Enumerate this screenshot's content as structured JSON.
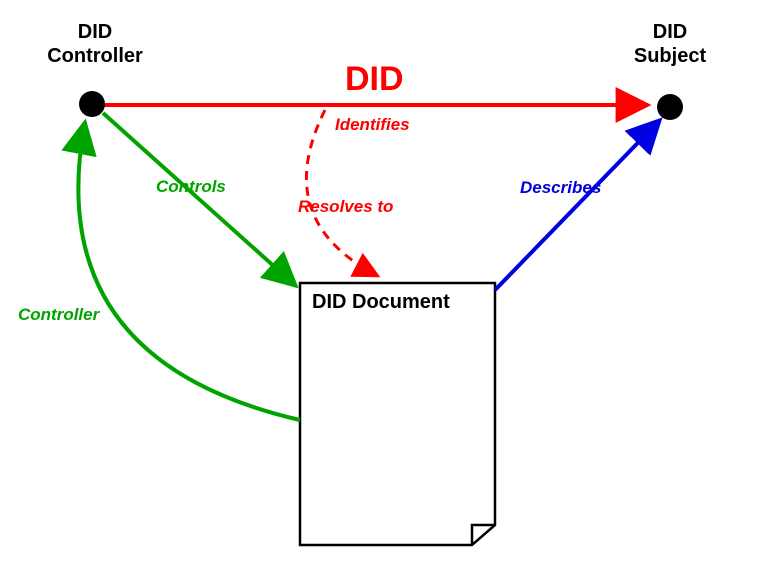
{
  "nodes": {
    "controller": {
      "label_line1": "DID",
      "label_line2": "Controller"
    },
    "subject": {
      "label_line1": "DID",
      "label_line2": "Subject"
    },
    "document": {
      "label": "DID Document"
    }
  },
  "edges": {
    "did": {
      "title": "DID",
      "label": "Identifies"
    },
    "resolves": {
      "label": "Resolves to"
    },
    "controls": {
      "label": "Controls"
    },
    "controller_back": {
      "label": "Controller"
    },
    "describes": {
      "label": "Describes"
    }
  },
  "colors": {
    "red": "#ff0000",
    "green": "#00a400",
    "blue": "#0000e0",
    "black": "#000000"
  }
}
